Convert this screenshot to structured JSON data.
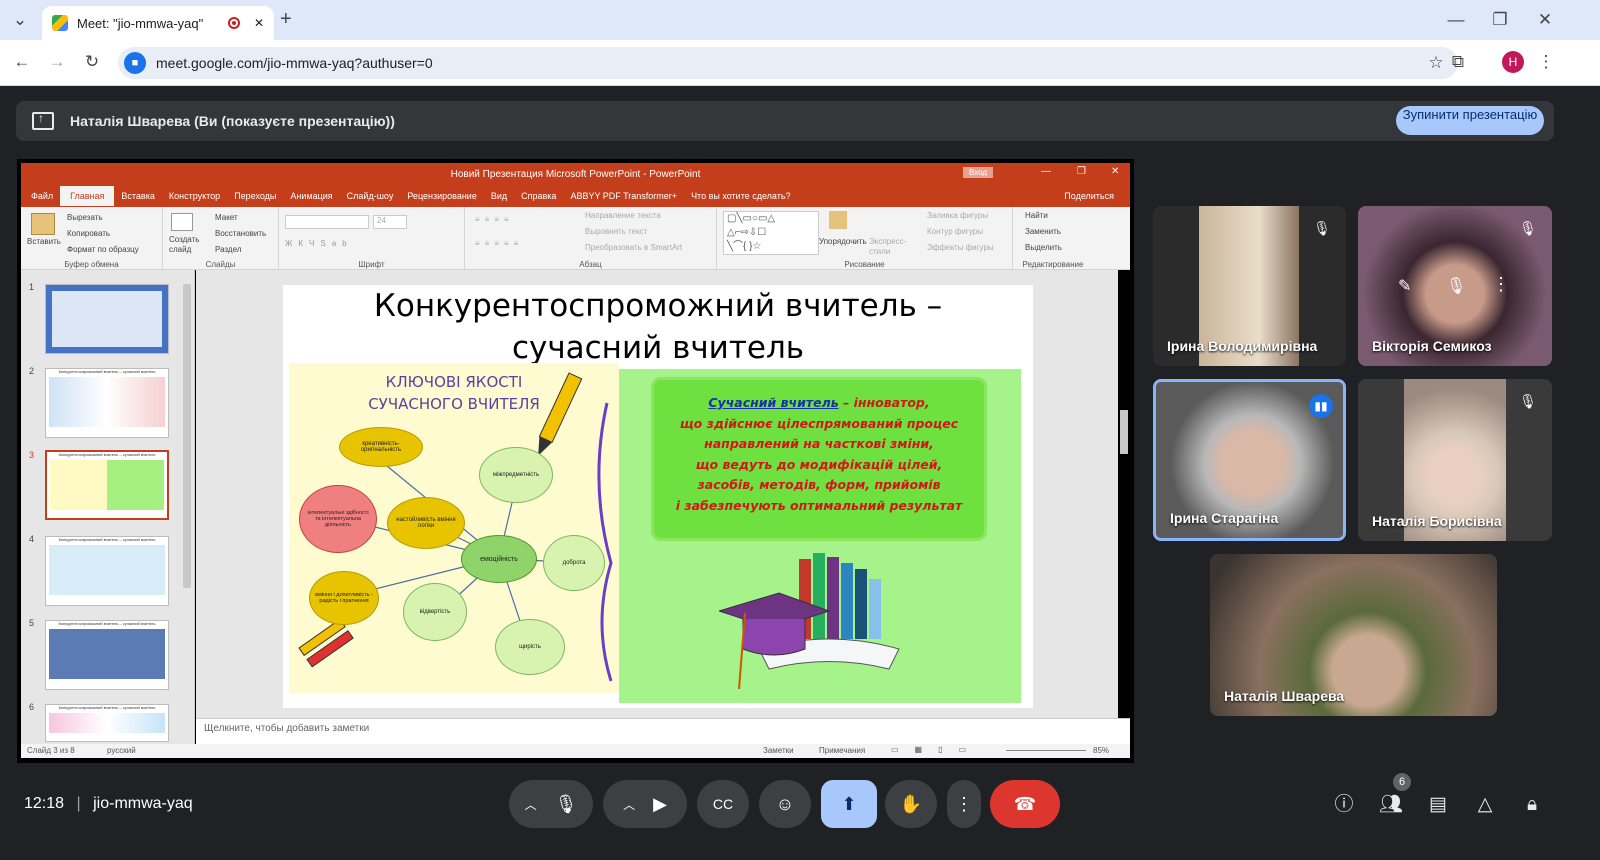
{
  "browser": {
    "tab_title": "Meet: \"jio-mmwa-yaq\"",
    "tab_close": "✕",
    "new_tab": "+",
    "url": "meet.google.com/jio-mmwa-yaq?authuser=0",
    "profile_initial": "H"
  },
  "banner": {
    "presenter_text": "Наталія Шварева (Ви (показуєте презентацію))",
    "stop_button": "Зупинити презентацію"
  },
  "powerpoint": {
    "window_title": "Новий Презентация Microsoft PowerPoint - PowerPoint",
    "signin": "Вход",
    "menu": [
      "Файл",
      "Главная",
      "Вставка",
      "Конструктор",
      "Переходы",
      "Анимация",
      "Слайд-шоу",
      "Рецензирование",
      "Вид",
      "Справка",
      "ABBYY PDF Transformer+",
      "Что вы хотите сделать?"
    ],
    "share": "Поделиться",
    "ribbon": {
      "clipboard": {
        "paste": "Вставить",
        "cut": "Вырезать",
        "copy": "Копировать",
        "format": "Формат по образцу",
        "label": "Буфер обмена"
      },
      "slides": {
        "create": "Создать слайд",
        "layout": "Макет",
        "restore": "Восстановить",
        "section": "Раздел",
        "label": "Слайды"
      },
      "font_label": "Шрифт",
      "font_size": "24",
      "paragraph": {
        "dir": "Направление текста",
        "align": "Выровнять текст",
        "smartart": "Преобразовать в SmartArt",
        "label": "Абзац"
      },
      "drawing": {
        "arrange": "Упорядочить",
        "express": "Экспресс-стили",
        "fill": "Заливка фигуры",
        "outline": "Контур фигуры",
        "effects": "Эффекты фигуры",
        "label": "Рисование"
      },
      "editing": {
        "find": "Найти",
        "replace": "Заменить",
        "select": "Выделить",
        "label": "Редактирование"
      }
    },
    "thumbnails": [
      "1",
      "2",
      "3",
      "4",
      "5",
      "6"
    ],
    "thumb_titles": [
      "",
      "Конкурентоспроможний вчитель – сучасний вчитель",
      "Конкурентоспроможний вчитель – сучасний вчитель",
      "Конкурентоспроможний вчитель – сучасний вчитель",
      "Конкурентоспроможний вчитель – сучасний вчитель",
      "Конкурентоспроможний вчитель – сучасний вчитель"
    ],
    "slide": {
      "title_line1": "Конкурентоспроможний вчитель –",
      "title_line2": "сучасний вчитель",
      "left_heading_1": "КЛЮЧОВІ ЯКОСТІ",
      "left_heading_2": "СУЧАСНОГО ВЧИТЕЛЯ",
      "bubbles": {
        "creativity": "креативність-оригінальність",
        "intellect": "інтелектуальні здібності та інтелектуальна діяльність",
        "persistence": "настойливість вміння логіки",
        "emotion": "емоційність",
        "interdisc": "міжпредметність",
        "kindness": "доброта",
        "openness": "відвертість",
        "sincerity": "щирість",
        "skill": "вміння і допитливість - радість і прагнення"
      },
      "def_title": "Сучасний вчитель",
      "def_dash": " – інноватор,",
      "def_lines": [
        "що здійснює цілеспрямований процес",
        "направлений на часткові зміни,",
        "що ведуть до модифікацій цілей,",
        "засобів, методів, форм, прийомів",
        "і забезпечують оптимальний результат"
      ]
    },
    "notes_placeholder": "Щелкните, чтобы добавить заметки",
    "status": {
      "slide_info": "Слайд 3 из 8",
      "lang": "русский",
      "notes": "Заметки",
      "comments": "Примечания",
      "zoom": "85%"
    }
  },
  "participants": [
    {
      "name": "Ірина Володимирівна",
      "muted": true
    },
    {
      "name": "Вікторія Семикоз",
      "muted": true
    },
    {
      "name": "Ірина Старагіна",
      "muted": false,
      "speaking": true
    },
    {
      "name": "Наталія Борисівна",
      "muted": true
    },
    {
      "name": "Наталія Шварева",
      "muted": false
    }
  ],
  "bottom": {
    "time": "12:18",
    "meeting_code": "jio-mmwa-yaq",
    "participants_count": "6"
  },
  "colors": {
    "accent": "#a8c7fa",
    "end_call": "#dc362e",
    "ppt": "#c43e1c"
  }
}
